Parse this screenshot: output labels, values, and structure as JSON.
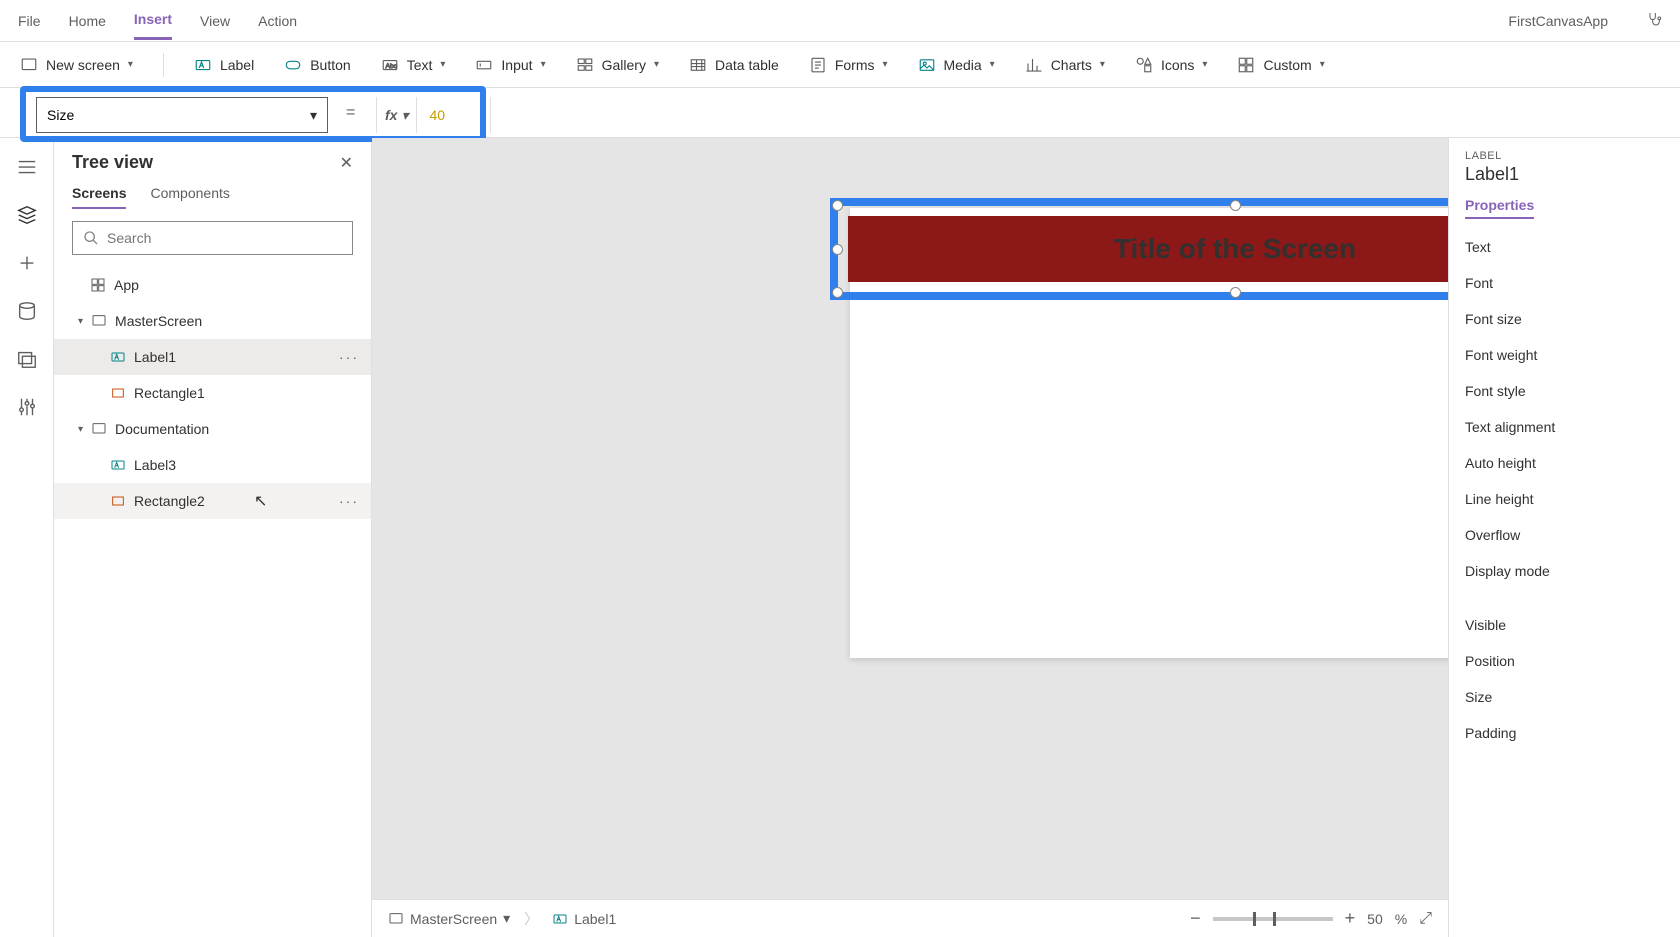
{
  "top_menu": {
    "items": [
      "File",
      "Home",
      "Insert",
      "View",
      "Action"
    ],
    "active": "Insert",
    "app_name": "FirstCanvasApp"
  },
  "ribbon": {
    "new_screen": "New screen",
    "label": "Label",
    "button": "Button",
    "text": "Text",
    "input": "Input",
    "gallery": "Gallery",
    "data_table": "Data table",
    "forms": "Forms",
    "media": "Media",
    "charts": "Charts",
    "icons": "Icons",
    "custom": "Custom"
  },
  "formula_bar": {
    "property": "Size",
    "value": "40"
  },
  "tree_view": {
    "title": "Tree view",
    "tabs": {
      "screens": "Screens",
      "components": "Components"
    },
    "search_placeholder": "Search",
    "app": "App",
    "items": [
      {
        "name": "MasterScreen",
        "type": "screen"
      },
      {
        "name": "Label1",
        "type": "label",
        "selected": true
      },
      {
        "name": "Rectangle1",
        "type": "rect"
      },
      {
        "name": "Documentation",
        "type": "screen"
      },
      {
        "name": "Label3",
        "type": "label"
      },
      {
        "name": "Rectangle2",
        "type": "rect",
        "hover": true
      }
    ]
  },
  "canvas": {
    "label_text": "Title of the Screen"
  },
  "breadcrumb": {
    "screen": "MasterScreen",
    "control": "Label1"
  },
  "zoom": {
    "value": "50",
    "unit": "%"
  },
  "properties": {
    "type_label": "LABEL",
    "name": "Label1",
    "tab": "Properties",
    "fields": [
      "Text",
      "Font",
      "Font size",
      "Font weight",
      "Font style",
      "Text alignment",
      "Auto height",
      "Line height",
      "Overflow",
      "Display mode"
    ],
    "fields2": [
      "Visible",
      "Position",
      "Size",
      "Padding"
    ]
  }
}
